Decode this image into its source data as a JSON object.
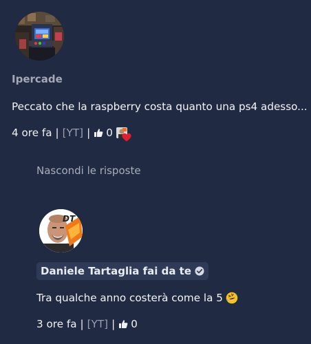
{
  "comment": {
    "author": "Ipercade",
    "avatar_icon": "arcade-cabinet-photo-avatar",
    "text": "Peccato che la raspberry costa quanto una ps4 adesso...",
    "time": "4 ore fa",
    "source": "[YT]",
    "separator": "|",
    "likes": "0",
    "like_icon": "thumbs-up-icon",
    "creator_heart": "heart-icon"
  },
  "replies_toggle": "Nascondi le risposte",
  "reply": {
    "author": "Daniele Tartaglia fai da te",
    "avatar_icon": "channel-owner-photo-avatar",
    "avatar_text": "DT",
    "verified_icon": "check-circle-icon",
    "text": "Tra qualche anno costerà come la 5",
    "emoji": "rolling-on-floor-laughing-emoji",
    "time": "3 ore fa",
    "source": "[YT]",
    "separator": "|",
    "likes": "0"
  },
  "colors": {
    "background": "#202a42",
    "author_pill": "#2f3b56",
    "muted_text": "#9aa0ad",
    "heart": "#e0202e"
  }
}
